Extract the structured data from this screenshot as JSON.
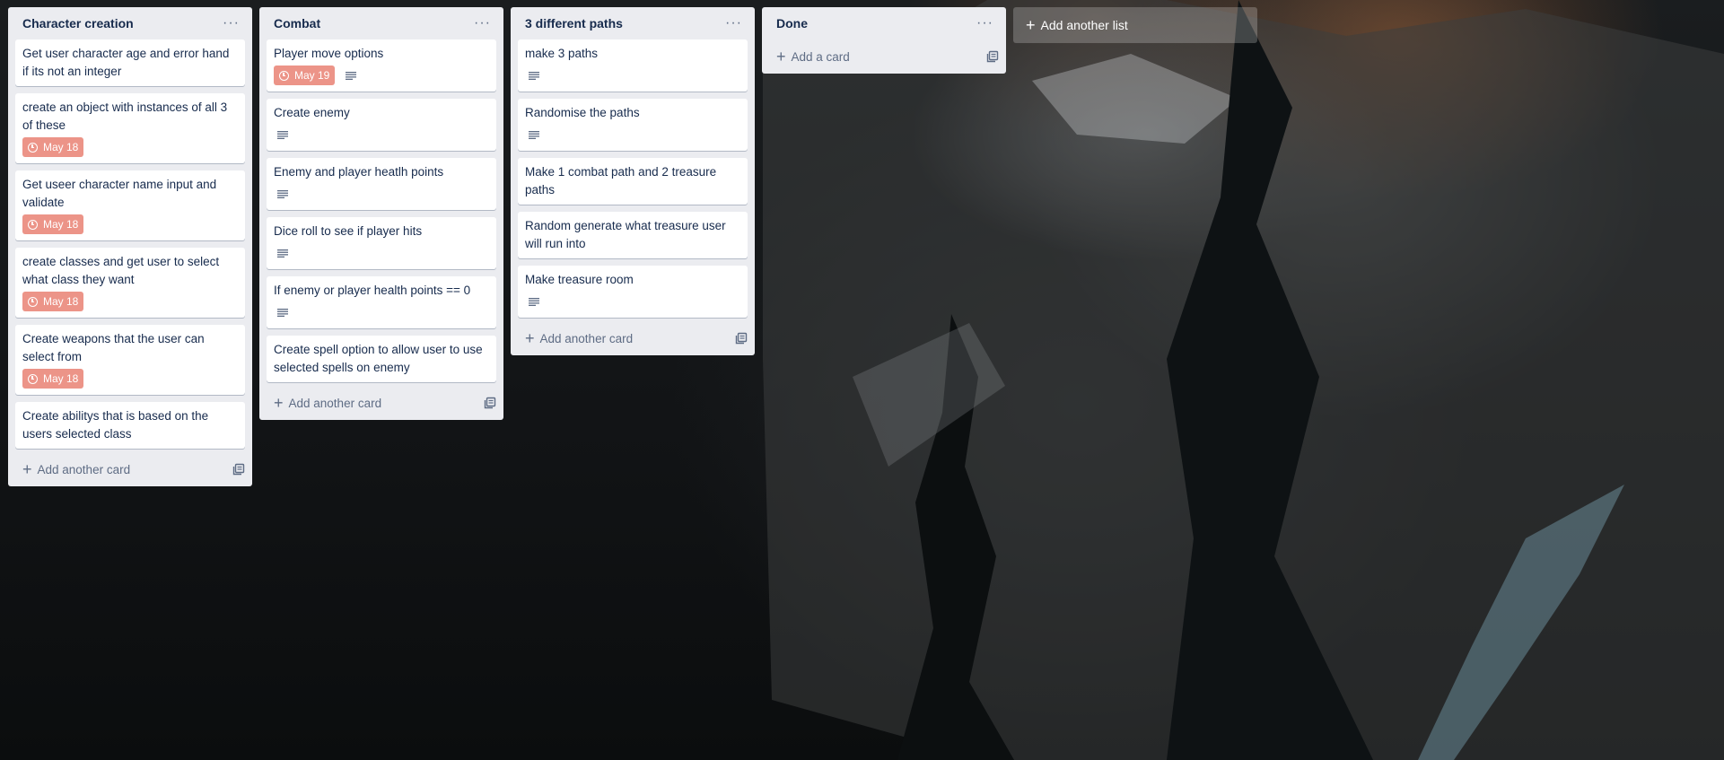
{
  "lists": [
    {
      "title": "Character creation",
      "cards": [
        {
          "title": "Get user character age and error hand if its not an integer",
          "due": null,
          "description": false
        },
        {
          "title": "create an object with instances of all 3 of these",
          "due": "May 18",
          "description": false
        },
        {
          "title": "Get useer character name input and validate",
          "due": "May 18",
          "description": false
        },
        {
          "title": "create classes and get user to select what class they want",
          "due": "May 18",
          "description": false
        },
        {
          "title": "Create weapons that the user can select from",
          "due": "May 18",
          "description": false
        },
        {
          "title": "Create abilitys that is based on the users selected class",
          "due": null,
          "description": false
        }
      ],
      "footer": "Add another card"
    },
    {
      "title": "Combat",
      "cards": [
        {
          "title": "Player move options",
          "due": "May 19",
          "description": true
        },
        {
          "title": "Create enemy",
          "due": null,
          "description": true
        },
        {
          "title": "Enemy and player heatlh points",
          "due": null,
          "description": true
        },
        {
          "title": "Dice roll to see if player hits",
          "due": null,
          "description": true
        },
        {
          "title": "If enemy or player health points == 0",
          "due": null,
          "description": true
        },
        {
          "title": "Create spell option to allow user to use selected spells on enemy",
          "due": null,
          "description": false
        }
      ],
      "footer": "Add another card"
    },
    {
      "title": "3 different paths",
      "cards": [
        {
          "title": "make 3 paths",
          "due": null,
          "description": true
        },
        {
          "title": "Randomise the paths",
          "due": null,
          "description": true
        },
        {
          "title": "Make 1 combat path and 2 treasure paths",
          "due": null,
          "description": false
        },
        {
          "title": "Random generate what treasure user will run into",
          "due": null,
          "description": false
        },
        {
          "title": "Make treasure room",
          "due": null,
          "description": true
        }
      ],
      "footer": "Add another card"
    },
    {
      "title": "Done",
      "cards": [],
      "footer": "Add a card"
    }
  ],
  "add_list_label": "Add another list",
  "menu_glyph": "···",
  "colors": {
    "list_bg": "#ebecf0",
    "due_badge": "#ec9488",
    "text": "#172b4d"
  },
  "icons": {
    "due": "clock-icon",
    "description": "description-icon",
    "add": "plus-icon",
    "template": "card-template-icon",
    "menu": "ellipsis-icon"
  }
}
